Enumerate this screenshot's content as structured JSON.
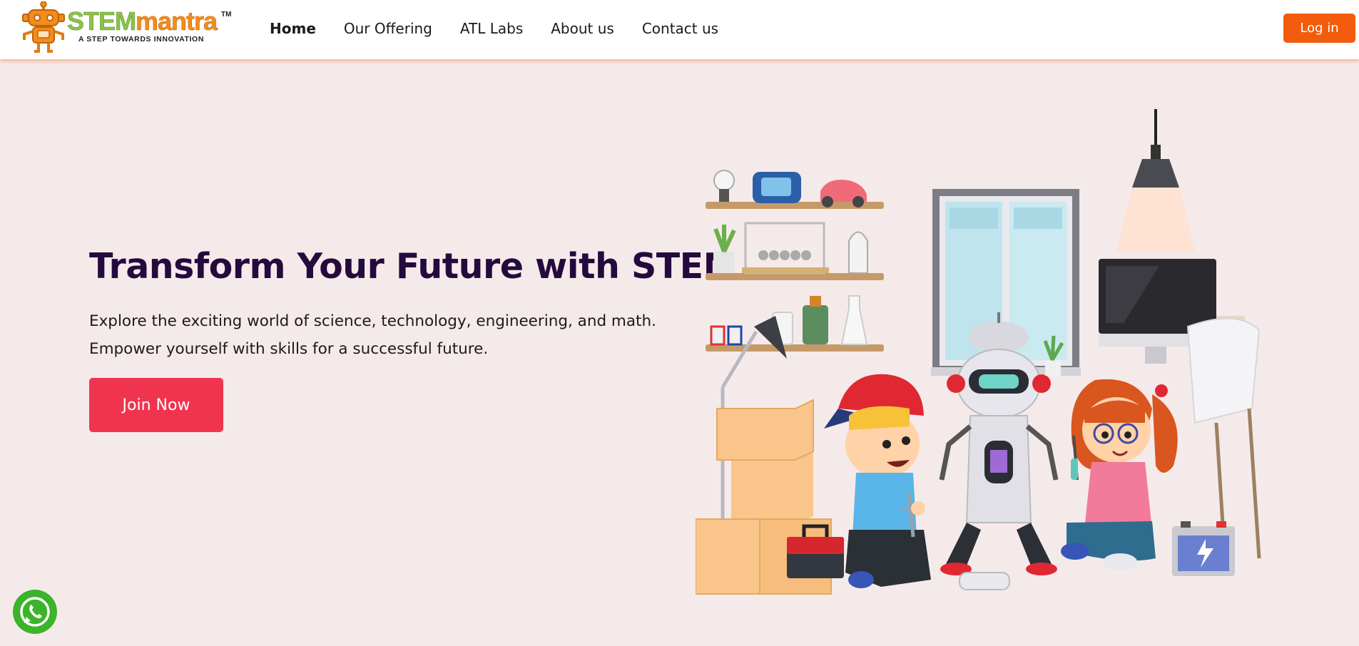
{
  "brand": {
    "name_part1": "STEM",
    "name_part2": "mantra",
    "trademark": "TM",
    "tagline": "A STEP TOWARDS INNOVATION"
  },
  "nav": {
    "items": [
      {
        "label": "Home",
        "active": true
      },
      {
        "label": "Our Offering",
        "active": false
      },
      {
        "label": "ATL Labs",
        "active": false
      },
      {
        "label": "About us",
        "active": false
      },
      {
        "label": "Contact us",
        "active": false
      }
    ],
    "login_label": "Log in"
  },
  "hero": {
    "title": "Transform Your Future with STEM",
    "description": "Explore the exciting world of science, technology, engineering, and math. Empower yourself with skills for a successful future.",
    "cta_label": "Join Now"
  },
  "floating": {
    "whatsapp_icon": "whatsapp-icon"
  },
  "colors": {
    "accent_orange": "#f25c0c",
    "cta_red": "#f0344f",
    "title_purple": "#240a3d",
    "hero_bg": "#f5eaea",
    "whatsapp_green": "#3bb32b"
  }
}
